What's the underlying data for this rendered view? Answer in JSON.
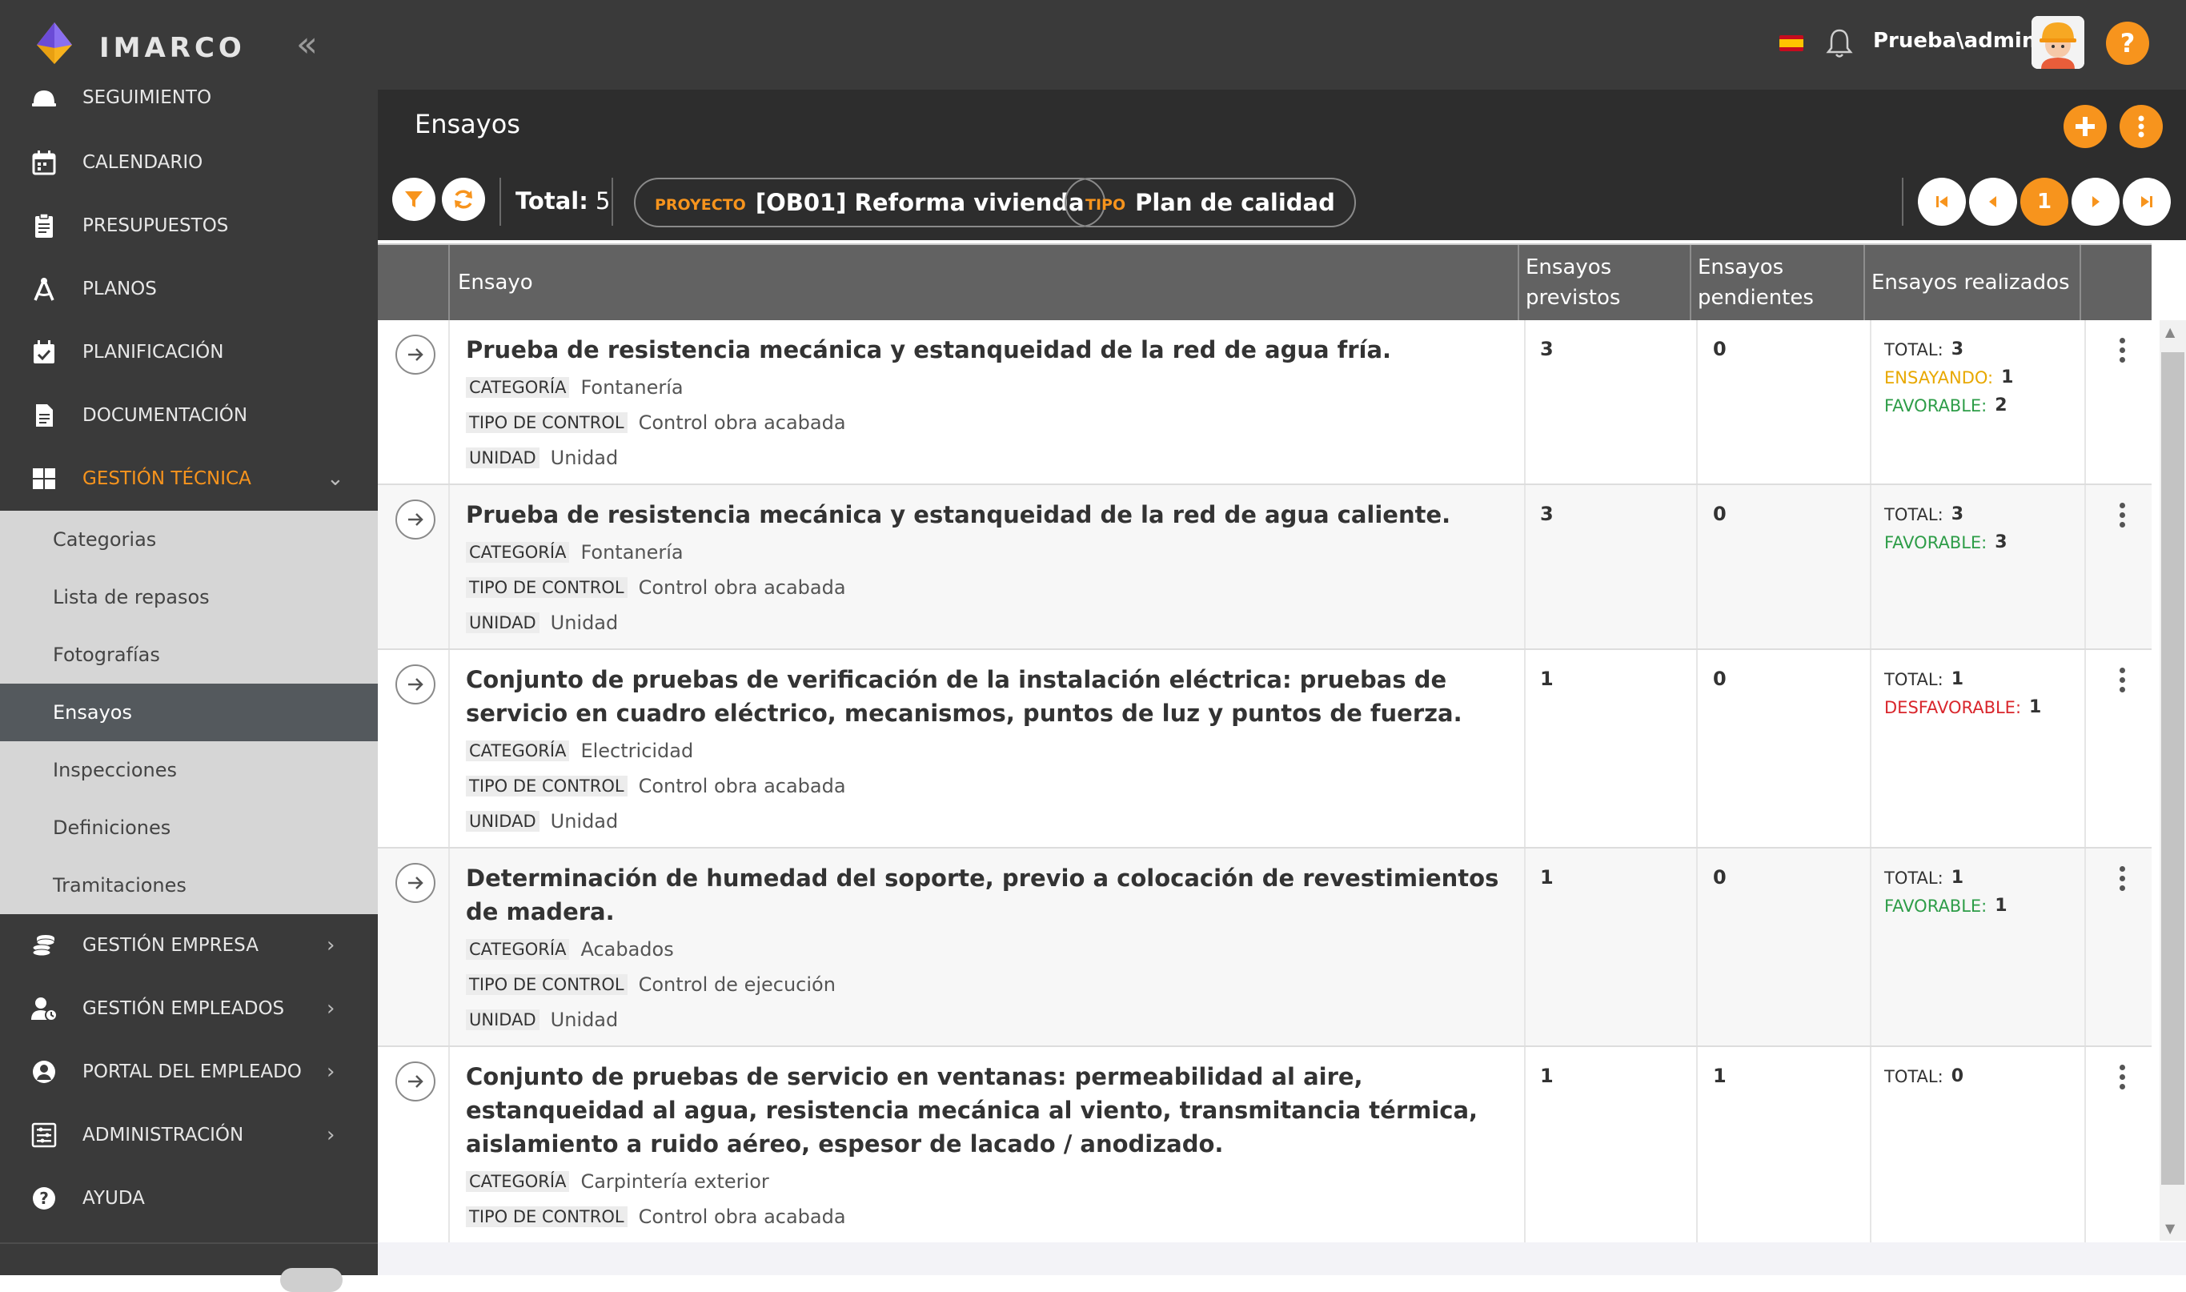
{
  "app": {
    "brand": "IMARCO",
    "user": "Prueba\\admin",
    "help_label": "?"
  },
  "sidebar": {
    "items": [
      {
        "label": "SEGUIMIENTO",
        "icon": "hard-hat-icon"
      },
      {
        "label": "CALENDARIO",
        "icon": "calendar-icon"
      },
      {
        "label": "PRESUPUESTOS",
        "icon": "clipboard-icon"
      },
      {
        "label": "PLANOS",
        "icon": "compass-icon"
      },
      {
        "label": "PLANIFICACIÓN",
        "icon": "calendar-check-icon"
      },
      {
        "label": "DOCUMENTACIÓN",
        "icon": "document-icon"
      },
      {
        "label": "GESTIÓN TÉCNICA",
        "icon": "grid-icon",
        "active": true
      },
      {
        "label": "GESTIÓN EMPRESA",
        "icon": "coins-icon"
      },
      {
        "label": "GESTIÓN EMPLEADOS",
        "icon": "user-clock-icon"
      },
      {
        "label": "PORTAL DEL EMPLEADO",
        "icon": "user-circle-icon"
      },
      {
        "label": "ADMINISTRACIÓN",
        "icon": "settings-list-icon"
      },
      {
        "label": "AYUDA",
        "icon": "help-circle-icon"
      }
    ],
    "submenu": [
      {
        "label": "Categorias"
      },
      {
        "label": "Lista de repasos"
      },
      {
        "label": "Fotografías"
      },
      {
        "label": "Ensayos",
        "selected": true
      },
      {
        "label": "Inspecciones"
      },
      {
        "label": "Definiciones"
      },
      {
        "label": "Tramitaciones"
      }
    ]
  },
  "page": {
    "title": "Ensayos"
  },
  "filters": {
    "total_label": "Total:",
    "total_value": "5",
    "project_label": "PROYECTO",
    "project_value": "[OB01] Reforma vivienda",
    "type_label": "TIPO",
    "type_value": "Plan de calidad",
    "current_page": "1"
  },
  "table": {
    "headers": {
      "ensayo": "Ensayo",
      "previstos": "Ensayos previstos",
      "pendientes": "Ensayos pendientes",
      "realizados": "Ensayos realizados"
    },
    "meta_labels": {
      "categoria": "CATEGORÍA",
      "tipo": "TIPO DE CONTROL",
      "unidad": "UNIDAD"
    },
    "rows": [
      {
        "title": "Prueba de resistencia mecánica y estanqueidad de la red de agua fría.",
        "categoria": "Fontanería",
        "tipo": "Control obra acabada",
        "unidad": "Unidad",
        "previstos": "3",
        "pendientes": "0",
        "stats": [
          {
            "label": "TOTAL:",
            "value": "3",
            "color": "#333333"
          },
          {
            "label": "ENSAYANDO:",
            "value": "1",
            "color": "#e8a800"
          },
          {
            "label": "FAVORABLE:",
            "value": "2",
            "color": "#2e9d48"
          }
        ]
      },
      {
        "title": "Prueba de resistencia mecánica y estanqueidad de la red de agua caliente.",
        "categoria": "Fontanería",
        "tipo": "Control obra acabada",
        "unidad": "Unidad",
        "previstos": "3",
        "pendientes": "0",
        "stats": [
          {
            "label": "TOTAL:",
            "value": "3",
            "color": "#333333"
          },
          {
            "label": "FAVORABLE:",
            "value": "3",
            "color": "#2e9d48"
          }
        ]
      },
      {
        "title": "Conjunto de pruebas de verificación de la instalación eléctrica: pruebas de servicio en cuadro eléctrico, mecanismos, puntos de luz y puntos de fuerza.",
        "categoria": "Electricidad",
        "tipo": "Control obra acabada",
        "unidad": "Unidad",
        "previstos": "1",
        "pendientes": "0",
        "stats": [
          {
            "label": "TOTAL:",
            "value": "1",
            "color": "#333333"
          },
          {
            "label": "DESFAVORABLE:",
            "value": "1",
            "color": "#d9262c"
          }
        ]
      },
      {
        "title": "Determinación de humedad del soporte, previo a colocación de revestimientos de madera.",
        "categoria": "Acabados",
        "tipo": "Control de ejecución",
        "unidad": "Unidad",
        "previstos": "1",
        "pendientes": "0",
        "stats": [
          {
            "label": "TOTAL:",
            "value": "1",
            "color": "#333333"
          },
          {
            "label": "FAVORABLE:",
            "value": "1",
            "color": "#2e9d48"
          }
        ]
      },
      {
        "title": "Conjunto de pruebas de servicio en ventanas: permeabilidad al aire, estanqueidad al agua, resistencia mecánica al viento, transmitancia térmica, aislamiento a ruido aéreo, espesor de lacado / anodizado.",
        "categoria": "Carpintería exterior",
        "tipo": "Control obra acabada",
        "previstos": "1",
        "pendientes": "1",
        "stats": [
          {
            "label": "TOTAL:",
            "value": "0",
            "color": "#333333"
          }
        ]
      }
    ]
  },
  "colors": {
    "accent": "#f7941d",
    "sidebar_bg": "#3a3a3a",
    "header_bg": "#2d2d2d",
    "table_header_bg": "#626262"
  }
}
